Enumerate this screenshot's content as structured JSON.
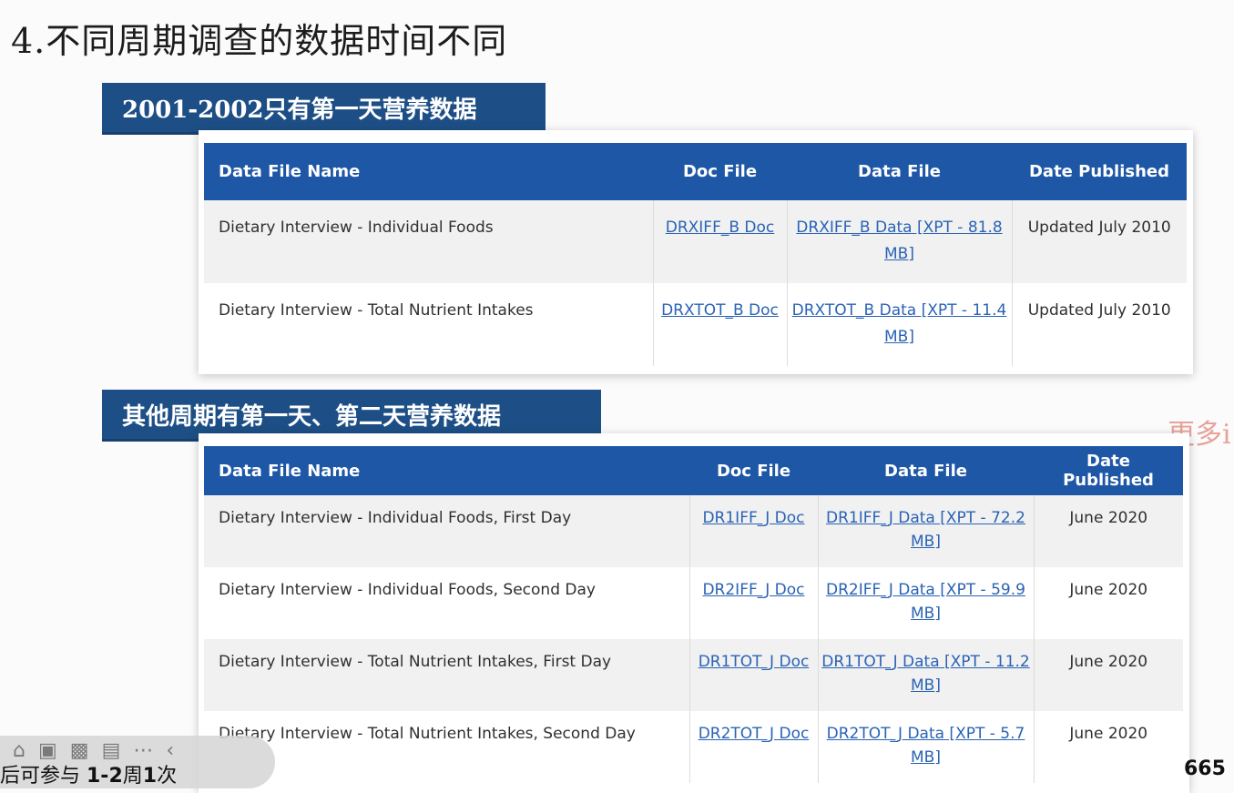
{
  "slide": {
    "title": "4.不同周期调查的数据时间不同",
    "banner_1": "2001-2002只有第一天营养数据",
    "banner_2": "其他周期有第一天、第二天营养数据",
    "more_link": "更多i"
  },
  "table_1": {
    "headers": [
      "Data File Name",
      "Doc File",
      "Data File",
      "Date Published"
    ],
    "rows": [
      {
        "name": "Dietary Interview - Individual Foods",
        "doc": "DRXIFF_B Doc",
        "data": "DRXIFF_B Data [XPT - 81.8 MB]",
        "date": "Updated July 2010"
      },
      {
        "name": "Dietary Interview - Total Nutrient Intakes",
        "doc": "DRXTOT_B Doc",
        "data": "DRXTOT_B Data [XPT - 11.4 MB]",
        "date": "Updated July 2010"
      }
    ]
  },
  "table_2": {
    "headers": [
      "Data File Name",
      "Doc File",
      "Data File",
      "Date Published"
    ],
    "rows": [
      {
        "name": "Dietary Interview - Individual Foods, First Day",
        "doc": "DR1IFF_J Doc",
        "data": "DR1IFF_J Data [XPT - 72.2 MB]",
        "date": "June 2020"
      },
      {
        "name": "Dietary Interview - Individual Foods, Second Day",
        "doc": "DR2IFF_J Doc",
        "data": "DR2IFF_J Data [XPT - 59.9 MB]",
        "date": "June 2020"
      },
      {
        "name": "Dietary Interview - Total Nutrient Intakes, First Day",
        "doc": "DR1TOT_J Doc",
        "data": "DR1TOT_J Data [XPT - 11.2 MB]",
        "date": "June 2020"
      },
      {
        "name": "Dietary Interview - Total Nutrient Intakes, Second Day",
        "doc": "DR2TOT_J Doc",
        "data": "DR2TOT_J Data [XPT - 5.7 MB]",
        "date": "June 2020"
      }
    ]
  },
  "footer": {
    "text_prefix": "后可参与 ",
    "text_bold_1": "1-2",
    "text_mid": "周",
    "text_bold_2": "1",
    "text_suffix": "次",
    "right_text": "665"
  },
  "overlay_icons": [
    "home-icon",
    "screenshot-icon",
    "video-icon",
    "document-icon",
    "more-icon",
    "chevron-left-icon"
  ]
}
